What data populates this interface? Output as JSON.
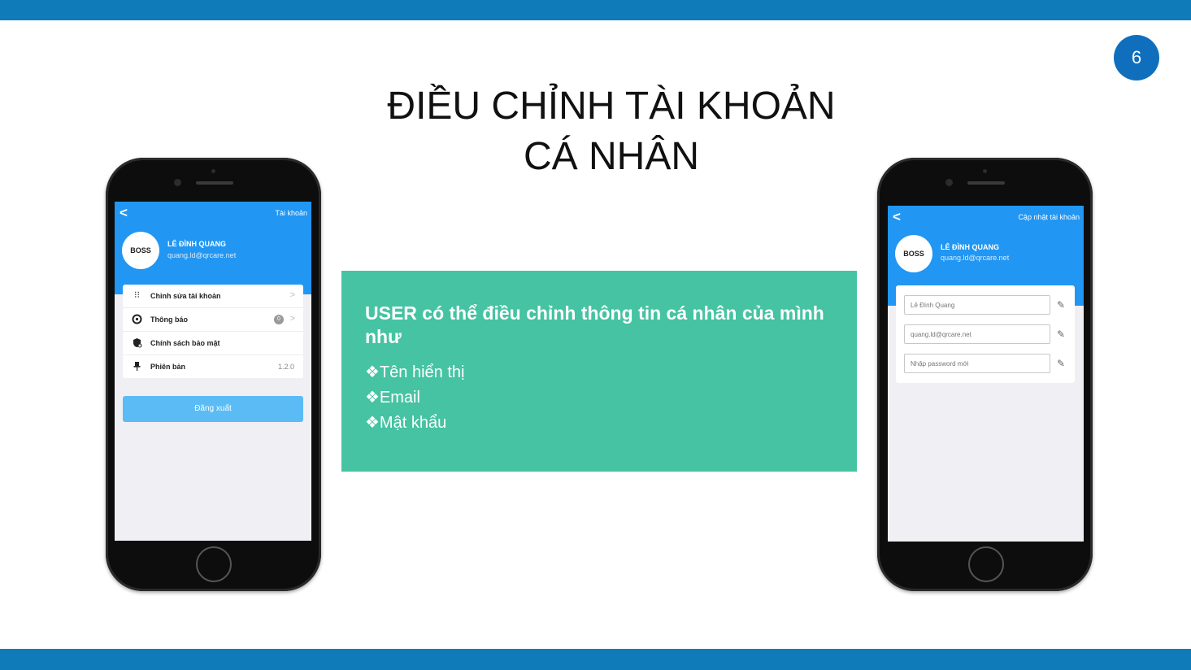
{
  "slide": {
    "page_number": "6",
    "title_line1": "ĐIỀU CHỈNH TÀI KHOẢN",
    "title_line2": "CÁ NHÂN"
  },
  "phone_left": {
    "nav_back": "<",
    "nav_title": "Tài khoản",
    "avatar_text": "BOSS",
    "user_name": "LÊ ĐÌNH QUANG",
    "user_email": "quang.ld@qrcare.net",
    "menu": [
      {
        "label": "Chỉnh sửa tài khoản",
        "icon": "edit-grid-icon",
        "chevron": ">"
      },
      {
        "label": "Thông báo",
        "icon": "bell-icon",
        "badge": "0",
        "chevron": ">"
      },
      {
        "label": "Chính sách bảo mật",
        "icon": "shield-icon"
      },
      {
        "label": "Phiên bản",
        "icon": "pin-icon",
        "value": "1.2.0"
      }
    ],
    "logout_label": "Đăng xuất"
  },
  "phone_right": {
    "nav_back": "<",
    "nav_title": "Cập nhật tài khoản",
    "avatar_text": "BOSS",
    "user_name": "LÊ ĐÌNH QUANG",
    "user_email": "quang.ld@qrcare.net",
    "fields": [
      {
        "placeholder": "Lê Đình Quang",
        "icon": "pencil-icon"
      },
      {
        "placeholder": "quang.ld@qrcare.net",
        "icon": "pencil-icon"
      },
      {
        "placeholder": "Nhập password mới",
        "icon": "pencil-icon"
      }
    ]
  },
  "info_box": {
    "heading": "USER có thể điều chỉnh thông tin cá nhân của mình như",
    "bullets": [
      "❖Tên hiển thị",
      "❖Email",
      "❖Mật khẩu"
    ]
  },
  "colors": {
    "accent_bar": "#0f7bb8",
    "app_blue": "#2196f3",
    "info_green": "#45c3a2",
    "logout_blue": "#5bbcf5"
  }
}
